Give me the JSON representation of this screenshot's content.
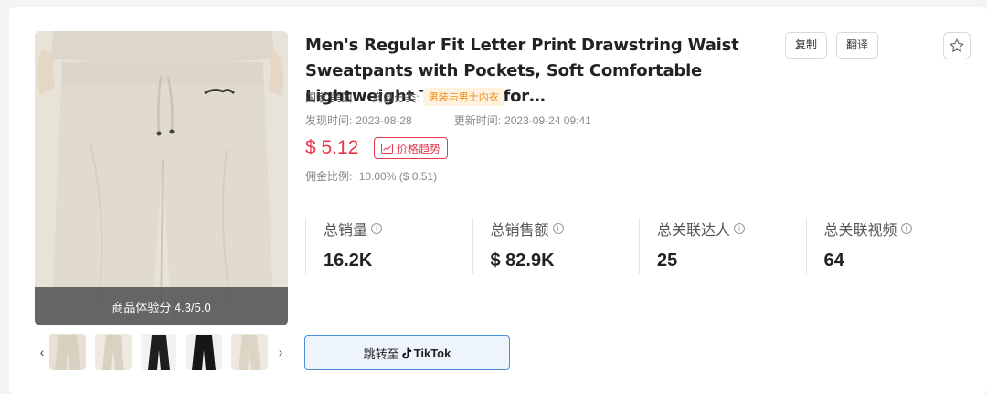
{
  "product": {
    "title": "Men's Regular Fit Letter Print Drawstring Waist Sweatpants with Pockets, Soft Comfortable Lightweight Trousers for…",
    "copy_label": "复制",
    "translate_label": "翻译",
    "country_label": "国家:",
    "country_value": "美国",
    "category_label": "商品分类:",
    "category_value": "男装与男士内衣",
    "found_label": "发现时间:",
    "found_value": "2023-08-28",
    "updated_label": "更新时间:",
    "updated_value": "2023-09-24 09:41",
    "price": "$ 5.12",
    "price_trend_label": "价格趋势",
    "commission_label": "佣金比例:",
    "commission_value": "10.00% ($ 0.51)",
    "score_text": "商品体验分 4.3/5.0"
  },
  "stats": [
    {
      "label": "总销量",
      "value": "16.2K"
    },
    {
      "label": "总销售额",
      "value": "$ 82.9K"
    },
    {
      "label": "总关联达人",
      "value": "25"
    },
    {
      "label": "总关联视频",
      "value": "64"
    }
  ],
  "tiktok": {
    "prefix": "跳转至",
    "brand": "TikTok"
  },
  "thumbnails": [
    "beige",
    "beige",
    "black",
    "black",
    "beige"
  ],
  "colors": {
    "price": "#e8364b",
    "tag_bg": "#fff3e0",
    "tag_text": "#f08c1a",
    "tiktok_border": "#4a8fd9"
  },
  "icons": {
    "prev": "chevron-left-icon",
    "next": "chevron-right-icon",
    "favorite": "star-icon",
    "trend": "chart-icon",
    "info": "info-icon",
    "tiktok": "tiktok-icon"
  }
}
